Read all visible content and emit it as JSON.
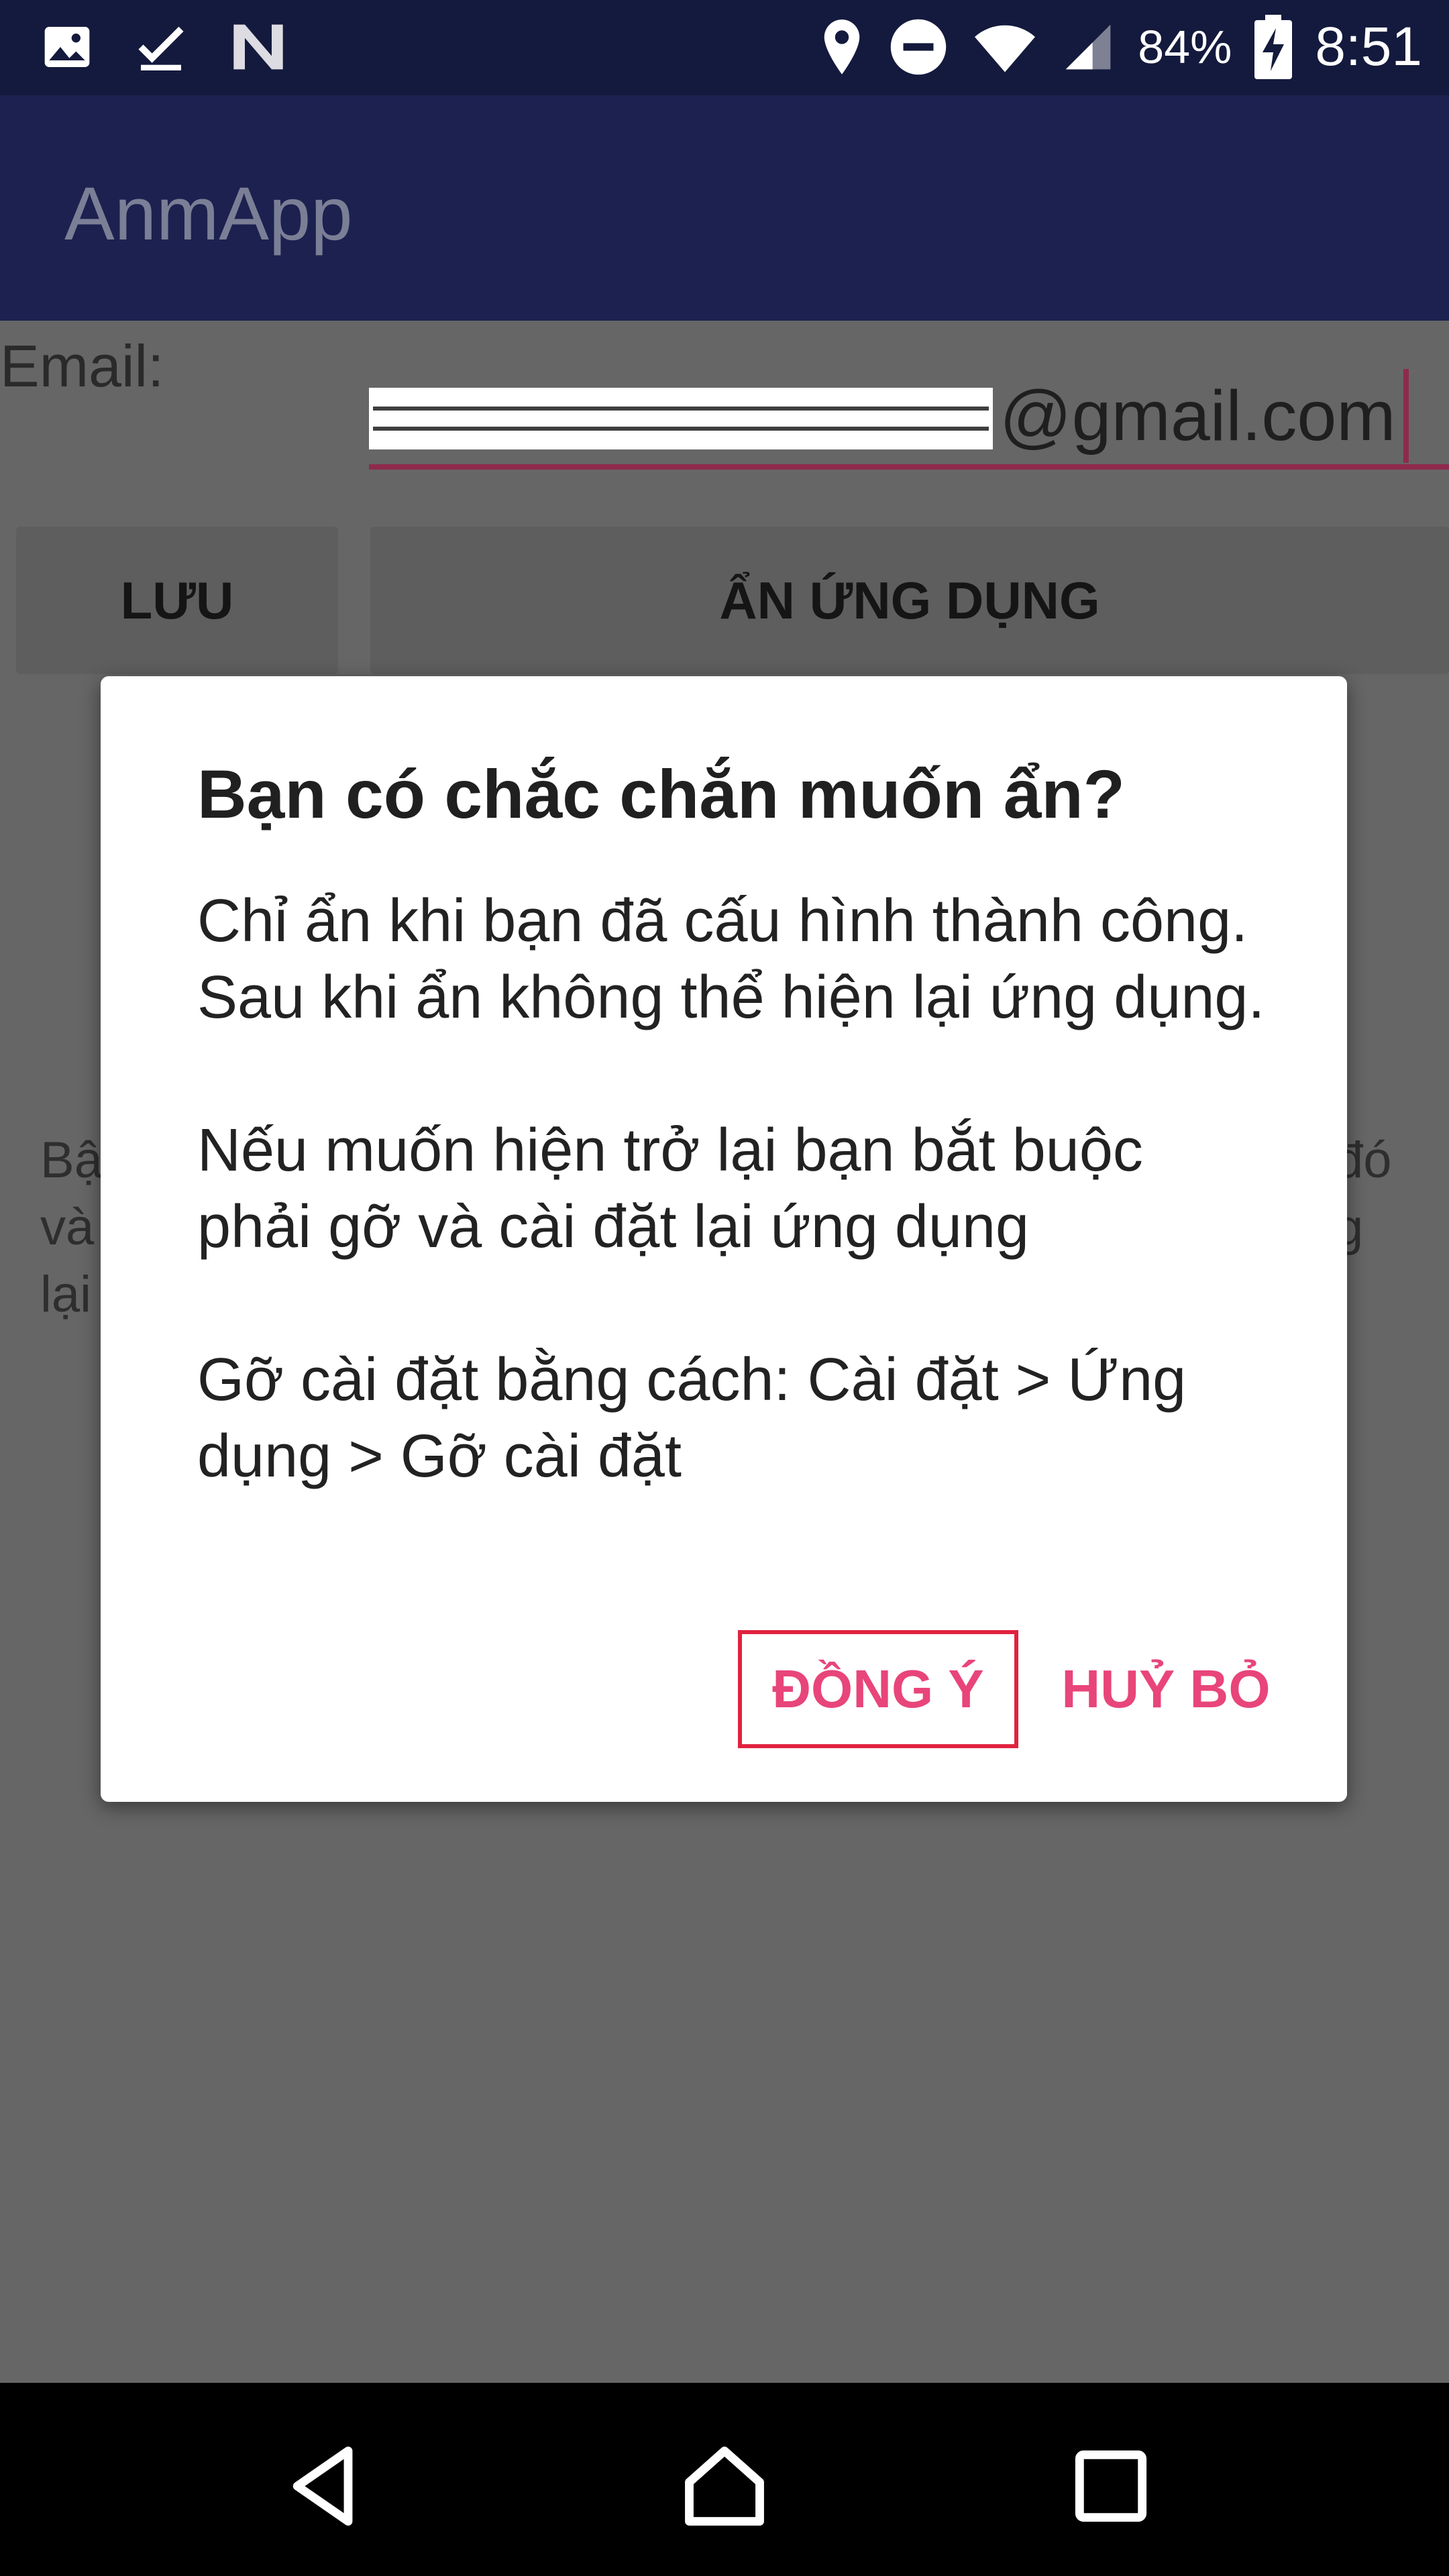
{
  "status_bar": {
    "left_icons": [
      "image-icon",
      "check-download-icon",
      "n-logo-icon"
    ],
    "right_icons": [
      "location-icon",
      "do-not-disturb-icon",
      "wifi-icon",
      "signal-icon"
    ],
    "battery_percent": "84%",
    "battery_icon": "battery-charging-icon",
    "time": "8:51"
  },
  "app_bar": {
    "title": "AnmApp",
    "background": "#1c2150"
  },
  "form": {
    "email_label": "Email:",
    "email_value_visible": "@gmail.com",
    "save_button": "LƯU",
    "hide_button": "ẨN ỨNG DỤNG"
  },
  "background_text": {
    "left_lines": [
      "Bậ",
      "và",
      "lại"
    ],
    "right_lines": [
      "đó",
      "g"
    ]
  },
  "dialog": {
    "title": "Bạn có chắc chắn muốn ẩn?",
    "message": "Chỉ ẩn khi bạn đã cấu hình thành công. Sau khi ẩn không thể hiện lại ứng dụng.\n\nNếu muốn hiện trở lại bạn bắt buộc phải gỡ và cài đặt lại ứng dụng\n\nGỡ cài đặt bằng cách: Cài đặt > Ứng dụng > Gỡ cài đặt",
    "ok_button": "ĐỒNG Ý",
    "cancel_button": "HUỶ BỎ",
    "accent_color": "#e8457a"
  },
  "nav_bar": {
    "icons": [
      "back-icon",
      "home-icon",
      "recents-icon"
    ]
  }
}
